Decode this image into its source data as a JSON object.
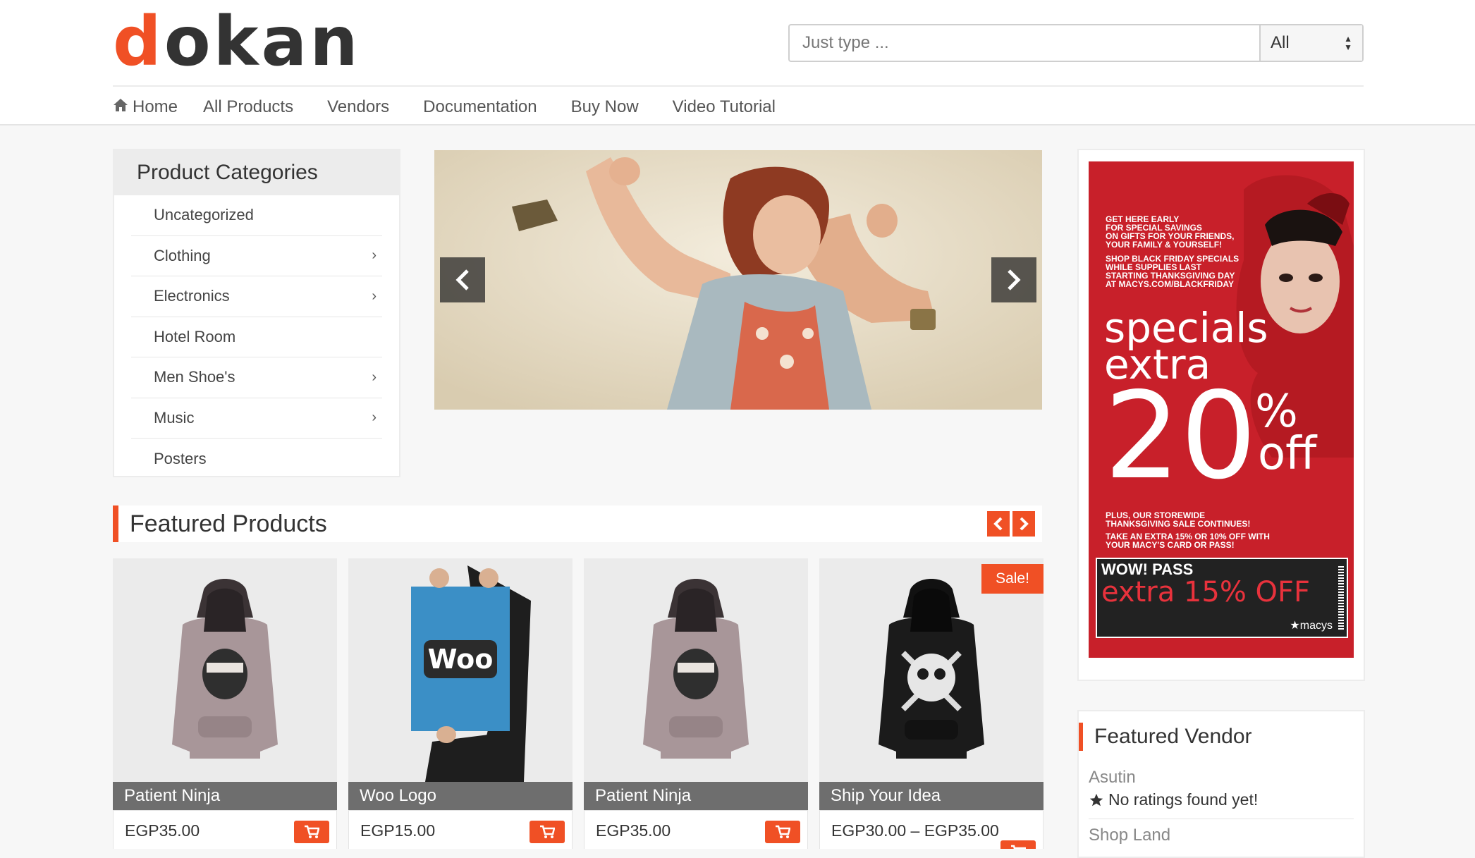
{
  "brand": {
    "logo_first": "d",
    "logo_rest": "okan",
    "accent_color": "#f05025"
  },
  "search": {
    "placeholder": "Just type ...",
    "category_selected": "All"
  },
  "nav": {
    "items": [
      {
        "label": "Home",
        "icon": "home-icon"
      },
      {
        "label": "All Products"
      },
      {
        "label": "Vendors"
      },
      {
        "label": "Documentation"
      },
      {
        "label": "Buy Now"
      },
      {
        "label": "Video Tutorial"
      }
    ]
  },
  "categories": {
    "title": "Product Categories",
    "items": [
      {
        "label": "Uncategorized",
        "has_children": false
      },
      {
        "label": "Clothing",
        "has_children": true
      },
      {
        "label": "Electronics",
        "has_children": true
      },
      {
        "label": "Hotel Room",
        "has_children": false
      },
      {
        "label": "Men Shoe's",
        "has_children": true
      },
      {
        "label": "Music",
        "has_children": true
      },
      {
        "label": "Posters",
        "has_children": false
      }
    ]
  },
  "featured": {
    "title": "Featured Products",
    "products": [
      {
        "name": "Patient Ninja",
        "price": "EGP35.00",
        "image": "grey-hoodie"
      },
      {
        "name": "Woo Logo",
        "price": "EGP15.00",
        "image": "woo-poster",
        "poster_text": "Woo"
      },
      {
        "name": "Patient Ninja",
        "price": "EGP35.00",
        "image": "grey-hoodie"
      },
      {
        "name": "Ship Your Idea",
        "price": "EGP30.00 – EGP35.00",
        "image": "black-hoodie",
        "badge": "Sale!"
      }
    ]
  },
  "ad": {
    "line1": "GET HERE EARLY",
    "line2": "FOR SPECIAL SAVINGS",
    "line3": "ON GIFTS FOR YOUR FRIENDS,",
    "line4": "YOUR FAMILY & YOURSELF!",
    "line5": "SHOP BLACK FRIDAY SPECIALS",
    "line6": "WHILE SUPPLIES LAST",
    "line7": "STARTING THANKSGIVING DAY",
    "line8": "AT MACYS.COM/BLACKFRIDAY",
    "specials": "specials",
    "extra": "extra",
    "twenty": "20",
    "percent": "%",
    "off": "off",
    "plus1": "PLUS, OUR STOREWIDE",
    "plus2": "THANKSGIVING SALE CONTINUES!",
    "plus3": "TAKE AN EXTRA 15% OR 10% OFF WITH",
    "plus4": "YOUR MACY'S CARD OR PASS!",
    "wow": "WOW! PASS",
    "wow_extra": "extra 15% OFF",
    "macys": "★macys"
  },
  "vendor": {
    "title": "Featured Vendor",
    "vendors": [
      {
        "name": "Asutin",
        "rating": "No ratings found yet!"
      },
      {
        "name": "Shop Land"
      }
    ]
  }
}
